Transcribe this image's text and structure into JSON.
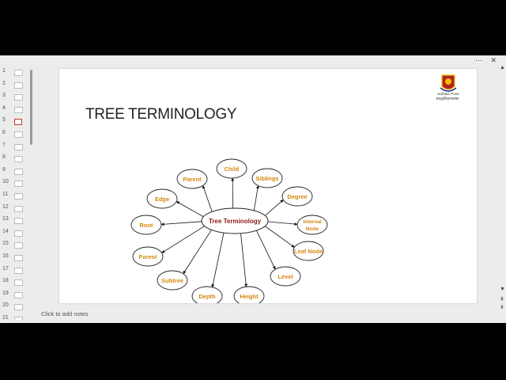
{
  "slide": {
    "title": "TREE TERMINOLOGY",
    "logo": {
      "line1": "Sarhad, Pune",
      "line2": "सरहद्शिक्षणसंस्था"
    },
    "diagram": {
      "center": "Tree Terminology",
      "nodes": [
        "Child",
        "Siblings",
        "Degree",
        "Internal Node",
        "Leaf Node",
        "Level",
        "Height",
        "Depth",
        "Subtree",
        "Forest",
        "Root",
        "Edge",
        "Parent"
      ]
    }
  },
  "thumbnails": [
    "1",
    "2",
    "3",
    "4",
    "5",
    "6",
    "7",
    "8",
    "9",
    "10",
    "11",
    "12",
    "13",
    "14",
    "15",
    "16",
    "17",
    "18",
    "19",
    "20",
    "21"
  ],
  "active_thumbnail": "5",
  "notes_placeholder": "Click to add notes",
  "colors": {
    "node_text": "#d4880f",
    "center_text": "#8b1a1a",
    "active_thumb": "#c0392b"
  }
}
